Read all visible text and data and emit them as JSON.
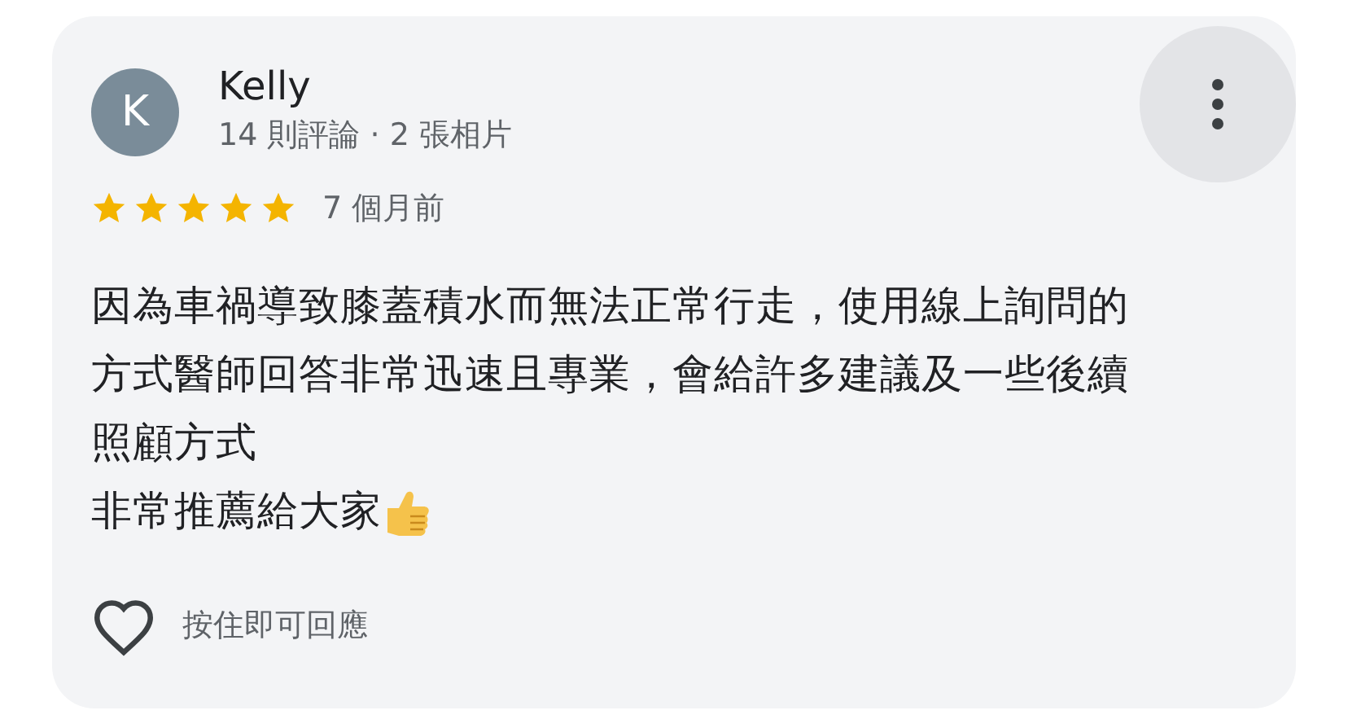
{
  "review": {
    "avatar_letter": "K",
    "name": "Kelly",
    "meta": "14 則評論 · 2 張相片",
    "stars": 5,
    "time": "7 個月前",
    "body_lines": [
      "因為車禍導致膝蓋積水而無法正常行走，使用線上詢問的",
      "方式醫師回答非常迅速且專業，會給許多建議及一些後續",
      "照顧方式",
      "非常推薦給大家"
    ],
    "liked": false,
    "reply_hint": "按住即可回應"
  }
}
